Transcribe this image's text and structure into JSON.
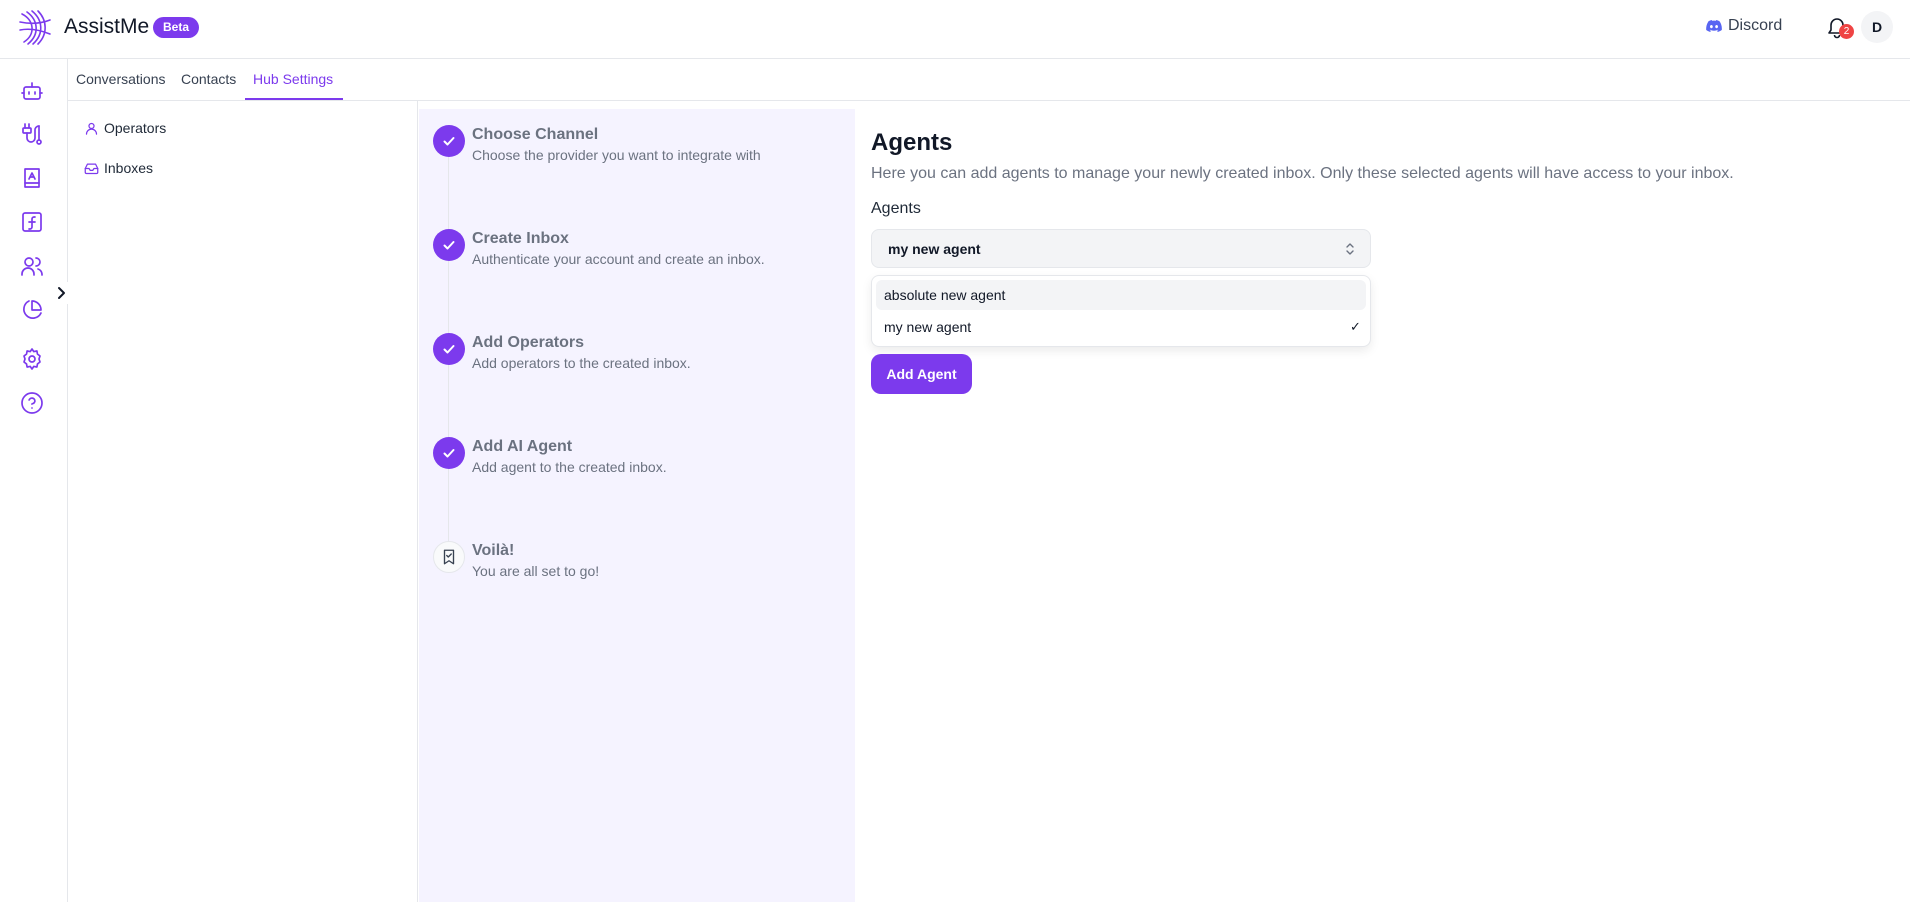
{
  "header": {
    "brand": "AssistMe",
    "badge": "Beta",
    "discord_label": "Discord",
    "notification_count": "2",
    "avatar_initial": "D"
  },
  "rail": {
    "icons": [
      "bot-icon",
      "workflow-icon",
      "contacts-book-icon",
      "function-icon",
      "users-icon",
      "pie-chart-icon",
      "gear-icon",
      "help-icon"
    ]
  },
  "tabs": [
    {
      "label": "Conversations",
      "active": false
    },
    {
      "label": "Contacts",
      "active": false
    },
    {
      "label": "Hub Settings",
      "active": true
    }
  ],
  "side_menu": {
    "items": [
      {
        "label": "Operators",
        "icon": "user-icon"
      },
      {
        "label": "Inboxes",
        "icon": "inbox-icon"
      }
    ]
  },
  "steps": [
    {
      "title": "Choose Channel",
      "description": "Choose the provider you want to integrate with",
      "status": "complete"
    },
    {
      "title": "Create Inbox",
      "description": "Authenticate your account and create an inbox.",
      "status": "complete"
    },
    {
      "title": "Add Operators",
      "description": "Add operators to the created inbox.",
      "status": "complete"
    },
    {
      "title": "Add AI Agent",
      "description": "Add agent to the created inbox.",
      "status": "complete"
    },
    {
      "title": "Voilà!",
      "description": "You are all set to go!",
      "status": "pending"
    }
  ],
  "main": {
    "title": "Agents",
    "description": "Here you can add agents to manage your newly created inbox. Only these selected agents will have access to your inbox.",
    "field_label": "Agents",
    "selected_value": "my new agent",
    "options": [
      {
        "label": "absolute new agent",
        "selected": false,
        "highlighted": true
      },
      {
        "label": "my new agent",
        "selected": true,
        "highlighted": false
      }
    ],
    "check_mark": "✓",
    "add_button_label": "Add Agent"
  },
  "colors": {
    "accent": "#7c3aed",
    "steps_bg": "#f5f3ff",
    "badge_red": "#ef4444"
  }
}
